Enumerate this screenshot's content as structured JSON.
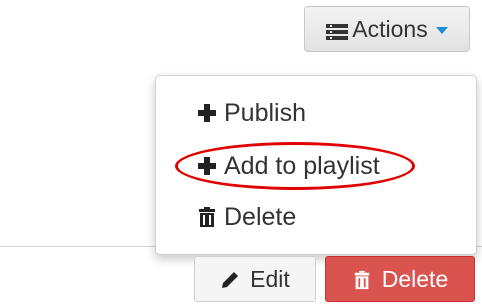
{
  "header": {
    "actions_label": "Actions",
    "actions_icon": "list-icon"
  },
  "menu": {
    "items": [
      {
        "label": "Publish",
        "icon": "plus-icon"
      },
      {
        "label": "Add to playlist",
        "icon": "plus-icon",
        "highlighted": true
      },
      {
        "label": "Delete",
        "icon": "trash-icon"
      }
    ]
  },
  "footer": {
    "edit_label": "Edit",
    "edit_icon": "pencil-icon",
    "delete_label": "Delete",
    "delete_icon": "trash-icon"
  },
  "colors": {
    "accent": "#1a8fd6",
    "danger": "#d9534f",
    "highlight": "#e00000"
  }
}
